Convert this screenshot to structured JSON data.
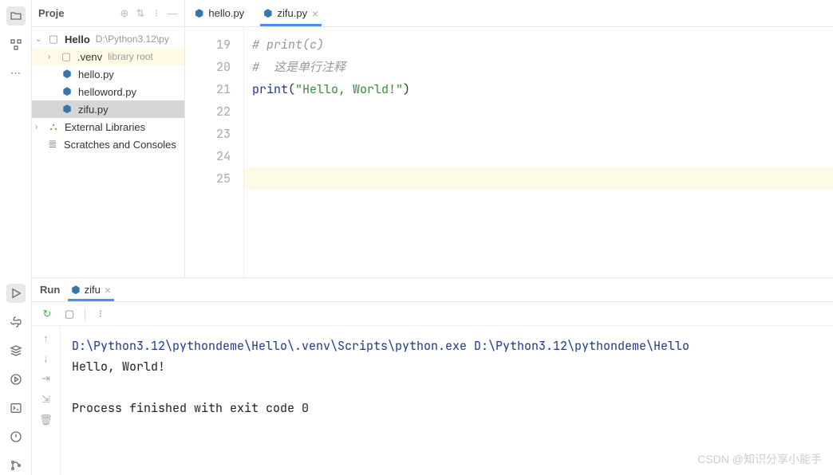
{
  "project": {
    "title": "Proje",
    "root": {
      "name": "Hello",
      "path": "D:\\Python3.12\\py"
    },
    "venv": {
      "name": ".venv",
      "hint": "library root"
    },
    "files": [
      "hello.py",
      "helloword.py",
      "zifu.py"
    ],
    "external": "External Libraries",
    "scratches": "Scratches and Consoles"
  },
  "tabs": [
    {
      "label": "hello.py"
    },
    {
      "label": "zifu.py"
    }
  ],
  "editor": {
    "line_numbers": [
      "19",
      "20",
      "21",
      "22",
      "23",
      "24",
      "25"
    ],
    "lines": {
      "l19": "# print(c)",
      "l20": "",
      "l21": "",
      "l22": "#  这是单行注释",
      "l23_func": "print",
      "l23_open": "(",
      "l23_str": "\"Hello, World!\"",
      "l23_close": ")",
      "l24": "",
      "l25": ""
    }
  },
  "run": {
    "title": "Run",
    "tab": "zifu",
    "cmd": "D:\\Python3.12\\pythondeme\\Hello\\.venv\\Scripts\\python.exe D:\\Python3.12\\pythondeme\\Hello",
    "output": "Hello, World!",
    "exit": "Process finished with exit code 0"
  },
  "watermark": "CSDN @知识分享小能手"
}
